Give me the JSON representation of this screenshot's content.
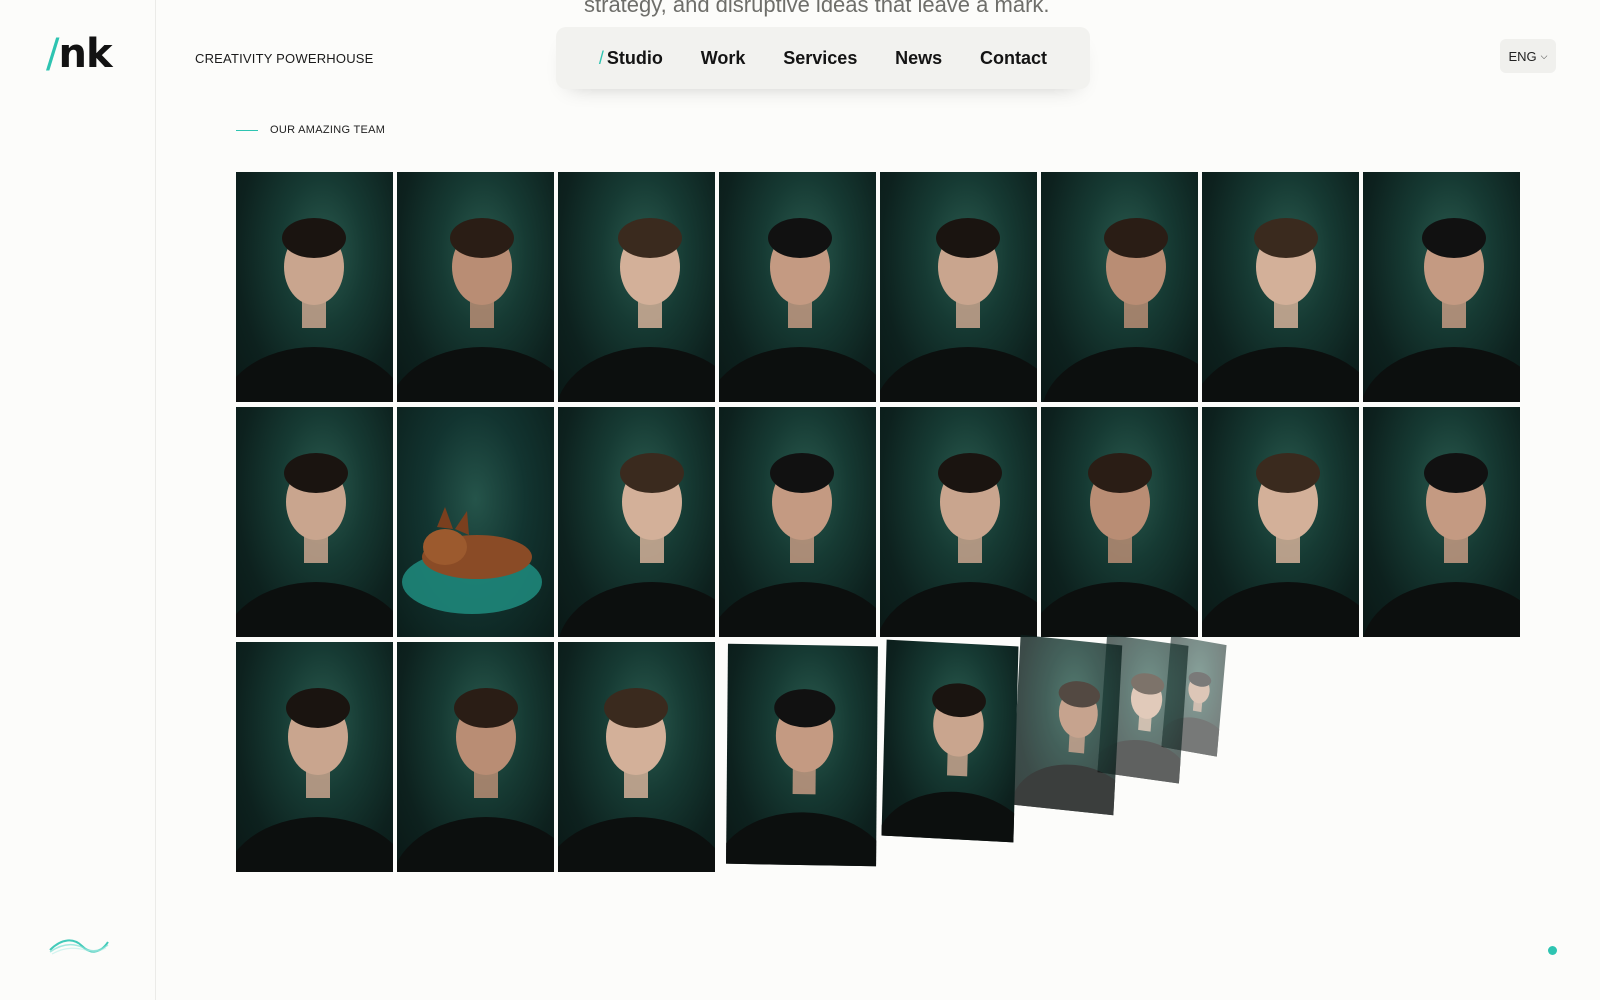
{
  "brand": {
    "logo_slash": "/",
    "logo_text": "nk",
    "tagline": "CREATIVITY POWERHOUSE"
  },
  "hero": {
    "line": "strategy, and disruptive ideas that leave a mark."
  },
  "nav": {
    "active_prefix": "/",
    "items": [
      {
        "label": "Studio",
        "active": true
      },
      {
        "label": "Work"
      },
      {
        "label": "Services"
      },
      {
        "label": "News"
      },
      {
        "label": "Contact"
      }
    ]
  },
  "language": {
    "selected": "ENG",
    "icon": "chevron-down-icon"
  },
  "team_section": {
    "label": "OUR AMAZING TEAM",
    "grid_photos": [
      "team-photo-woman-glasses-curly-hair",
      "team-photo-man-sunglasses",
      "team-photo-man-smiling",
      "team-photo-man-beard",
      "team-photo-man-smiling-short-hair",
      "team-photo-woman-long-hair",
      "team-photo-man-glasses",
      "team-photo-man-beard-dark-hair",
      "team-photo-young-man",
      "team-photo-dog-on-cushion",
      "team-photo-woman-smiling",
      "team-photo-woman-curly-updo",
      "team-photo-man-hoodie",
      "team-photo-bald-man",
      "team-photo-man-dark-hair",
      "team-photo-man-stubble",
      "team-photo-man-beard-short-hair",
      "team-photo-woman-long-hair-smiling",
      "team-photo-man-thumbs-up"
    ],
    "falling_photos": [
      "team-photo-man-serious",
      "team-photo-man-glasses-beard",
      "team-photo-man-beanie",
      "team-photo-young-man-blond",
      "team-photo-woman-blond"
    ]
  },
  "colors": {
    "accent": "#2ec4b1",
    "background": "#fcfcfa",
    "photo_bg": "#163a33"
  }
}
